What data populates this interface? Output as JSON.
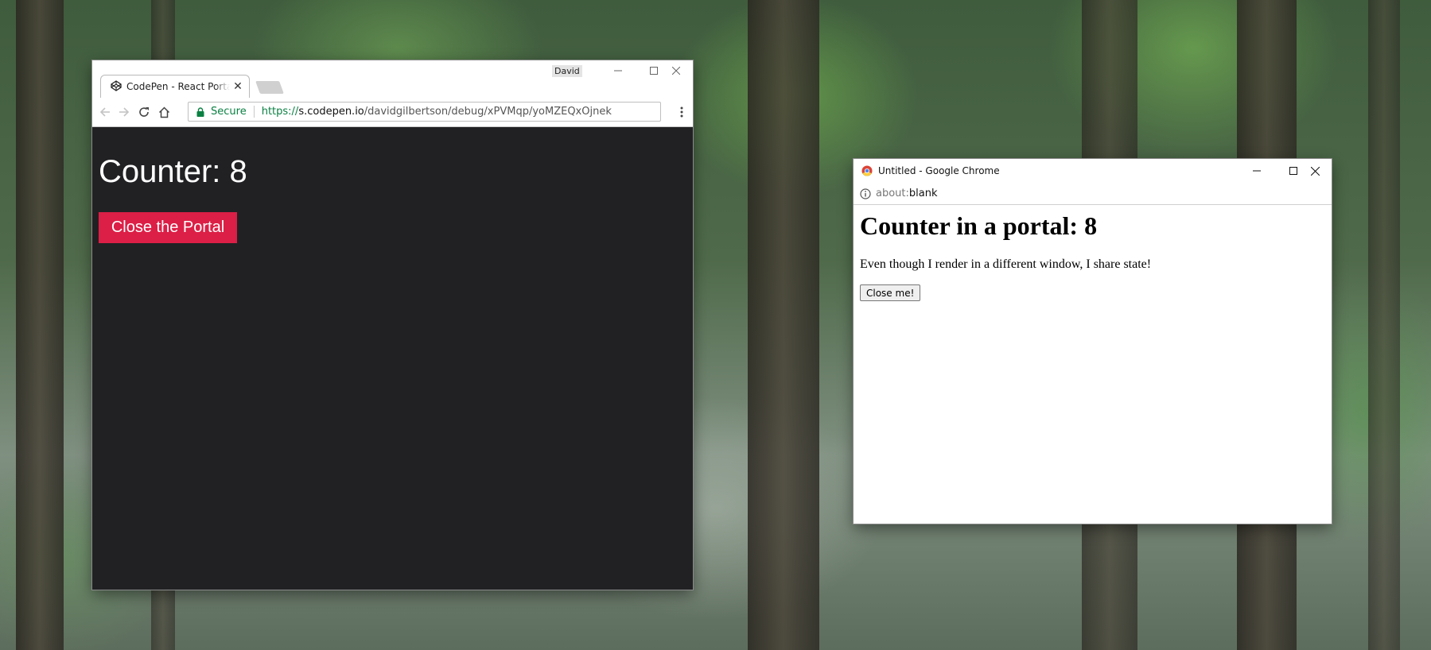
{
  "codepen_window": {
    "tab_title": "CodePen - React Portal C",
    "profile_name": "David",
    "omnibox": {
      "security_label": "Secure",
      "url_scheme": "https://",
      "url_host": "s.codepen.io",
      "url_path": "/davidgilbertson/debug/xPVMqp/yoMZEQxOjnek"
    },
    "counter_text": "Counter: 8",
    "close_portal_label": "Close the Portal",
    "accent_color": "#dc1f46",
    "background_color": "#212124"
  },
  "portal_window": {
    "title": "Untitled - Google Chrome",
    "address_scheme": "about:",
    "address_path": "blank",
    "heading": "Counter in a portal: 8",
    "paragraph": "Even though I render in a different window, I share state!",
    "close_button_label": "Close me!"
  },
  "icons": {
    "tab_favicon": "codepen-logo-icon",
    "tab_close": "close-icon",
    "back": "back-arrow-icon",
    "forward": "forward-arrow-icon",
    "reload": "reload-icon",
    "home": "home-icon",
    "lock": "lock-icon",
    "menu": "kebab-menu-icon",
    "minimize": "minimize-icon",
    "maximize": "maximize-icon",
    "close": "close-icon",
    "chrome_logo": "chrome-logo-icon",
    "info": "info-icon"
  }
}
